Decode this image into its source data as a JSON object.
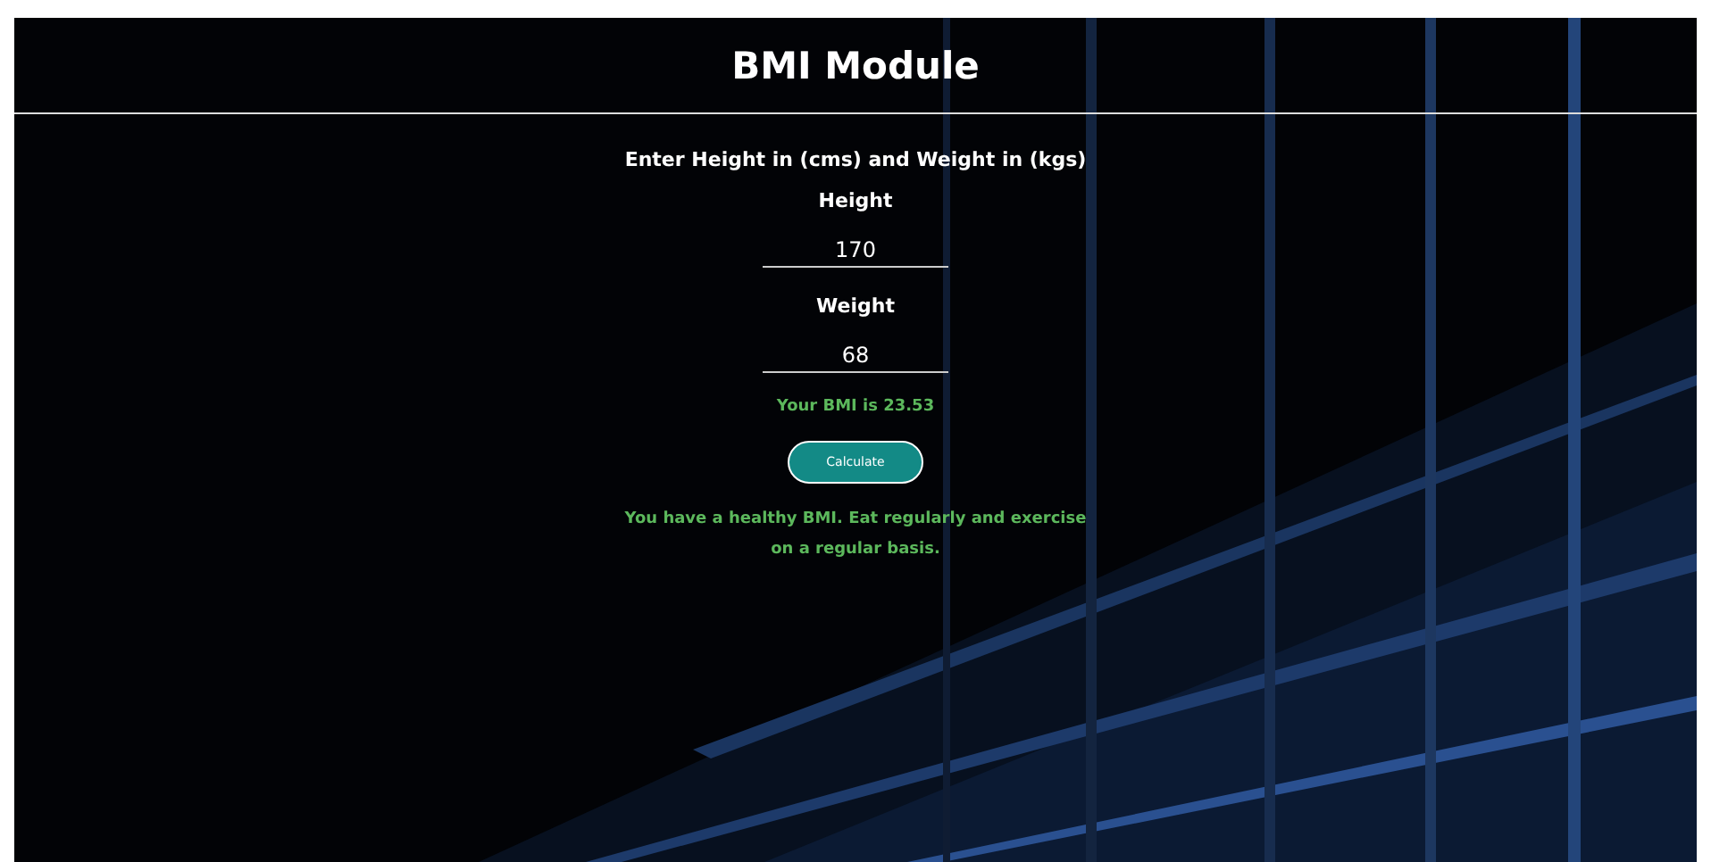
{
  "title": "BMI Module",
  "instructions": "Enter Height in (cms) and Weight in (kgs)",
  "fields": [
    {
      "label": "Height",
      "value": "170"
    },
    {
      "label": "Weight",
      "value": "68"
    }
  ],
  "result": "Your BMI is 23.53",
  "button": "Calculate",
  "message": "You have a healthy BMI. Eat regularly and exercise on a regular basis."
}
